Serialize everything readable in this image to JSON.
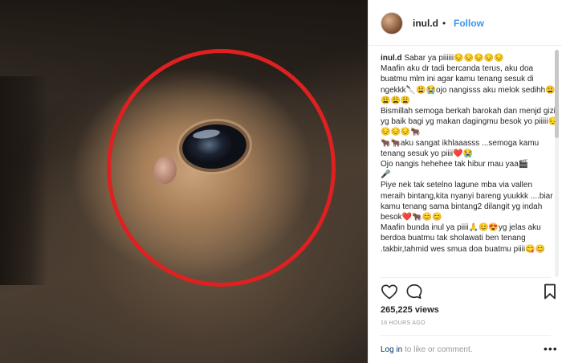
{
  "post": {
    "username": "inul.d",
    "separator": "•",
    "follow_label": "Follow",
    "caption_lines": [
      "Sabar ya piiiiii😔😔😔😔😔",
      "Maafin aku dr tadi bercanda terus, aku doa buatmu mlm ini agar kamu tenang sesuk di ngekkk🔪😩😭ojo nangisss aku melok sedihh😩😩😩😩",
      "Bismillah semoga berkah barokah dan menjd gizi yg baik bagi yg makan dagingmu besok yo piiiii😔😔😔😔🐂",
      "🐂🐂aku sangat ikhlaaasss ...semoga kamu tenang sesuk yo piiii❤️😭",
      "Ojo nangis hehehee tak hibur mau yaa🎬",
      "🎤",
      "Piye nek tak setelno lagune mba via vallen meraih bintang,kita nyanyi bareng yuukkk ....biar kamu tenang sama bintang2 dilangit yg indah besok❤️🐂😊😊",
      "Maafin bunda inul ya piiii🙏😊😍yg jelas aku berdoa buatmu tak sholawati ben tenang .takbir,tahmid wes smua doa buatmu piiii😋😊"
    ],
    "views": "265,225 views",
    "timestamp": "16 HOURS AGO",
    "footer": {
      "login_label": "Log in",
      "suffix": "to like or comment.",
      "more_glyph": "•••"
    }
  },
  "icons": {
    "heart": "heart-icon",
    "comment": "comment-icon",
    "bookmark": "bookmark-icon",
    "verified": "verified-badge-icon"
  },
  "colors": {
    "accent": "#3897f0",
    "annotation_circle": "#e02020",
    "link": "#003569",
    "muted": "#999999"
  }
}
